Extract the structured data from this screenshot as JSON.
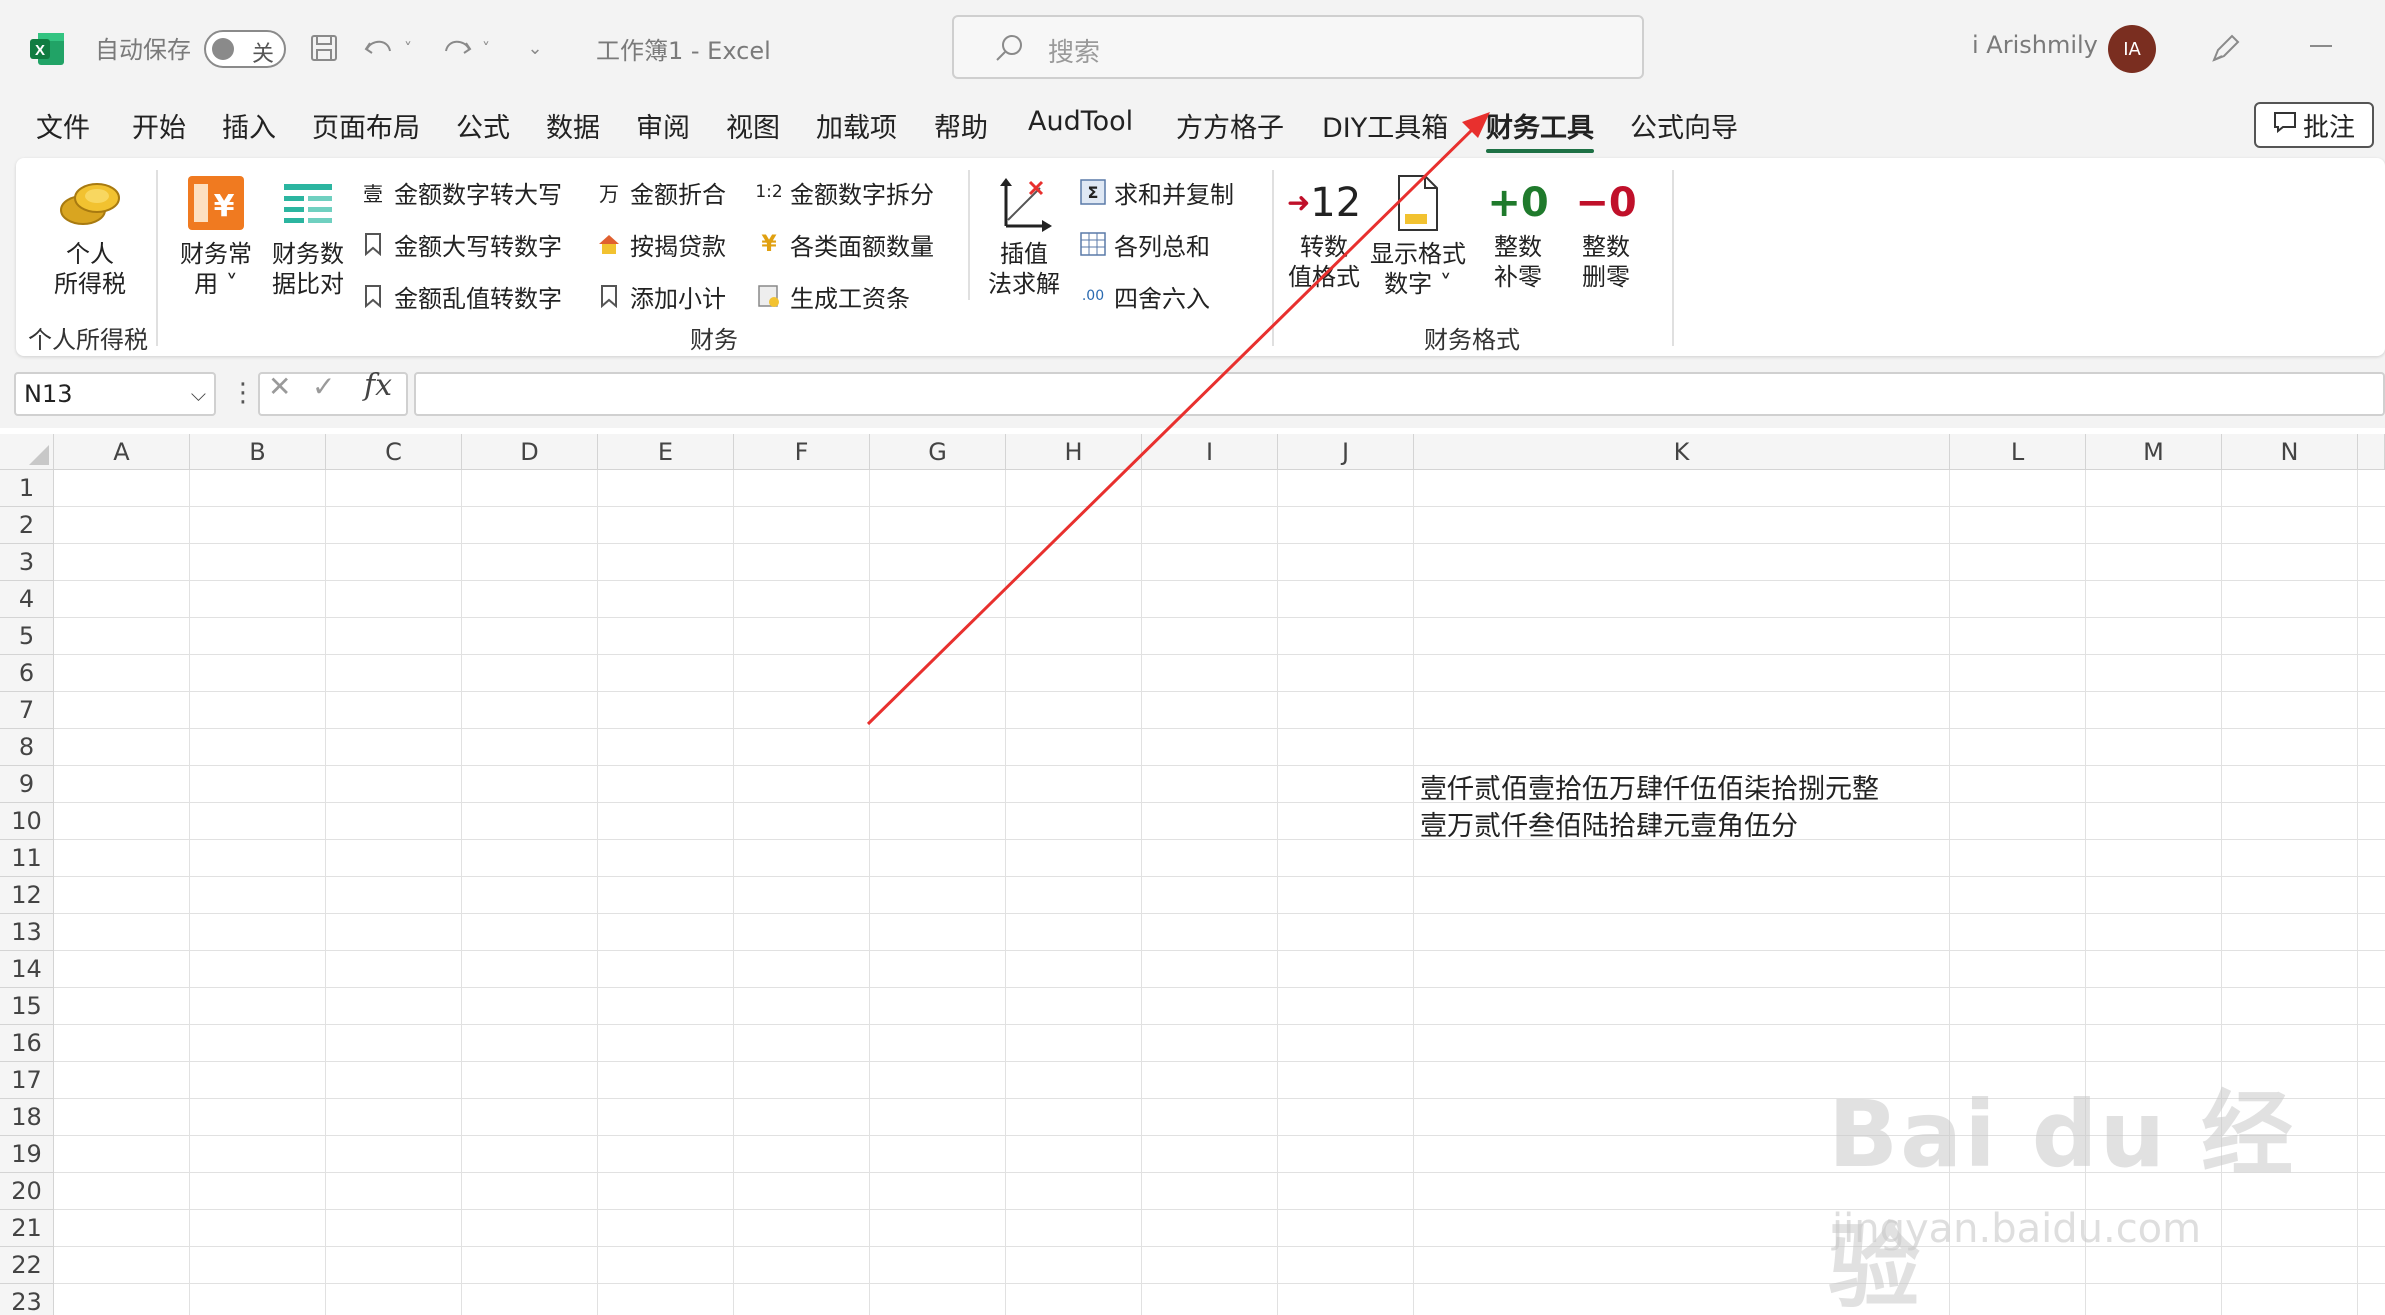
{
  "titlebar": {
    "autosave_label": "自动保存",
    "autosave_state": "关",
    "doc_title": "工作簿1  -  Excel",
    "search_placeholder": "搜索",
    "user_name": "i Arishmily",
    "avatar_initials": "IA"
  },
  "menu": {
    "tabs": [
      "文件",
      "开始",
      "插入",
      "页面布局",
      "公式",
      "数据",
      "审阅",
      "视图",
      "加载项",
      "帮助",
      "AudTool",
      "方方格子",
      "DIY工具箱",
      "财务工具",
      "公式向导"
    ],
    "active_tab": "财务工具",
    "comment_button": "批注"
  },
  "ribbon": {
    "group1": {
      "label": "个人所得税",
      "btn_income_tax": "个人\n所得税"
    },
    "group2": {
      "label": "财务",
      "btn_common": "财务常\n用 ˅",
      "btn_compare": "财务数\n据比对",
      "col1": [
        "金额数字转大写",
        "金额大写转数字",
        "金额乱值转数字"
      ],
      "col2": [
        "金额折合",
        "按揭贷款",
        "添加小计"
      ],
      "col3": [
        "金额数字拆分",
        "各类面额数量",
        "生成工资条"
      ],
      "btn_interp": "插值\n法求解",
      "col4": [
        "求和并复制",
        "各列总和",
        "四舍六入"
      ]
    },
    "group3": {
      "label": "财务格式",
      "btn_convert": "转数\n值格式",
      "btn_display": "显示格式\n数字 ˅",
      "btn_pad": "整数\n补零",
      "btn_delete": "整数\n删零",
      "icon_convert": "12",
      "icon_pad": "+0",
      "icon_delete": "−0"
    }
  },
  "formula_bar": {
    "name_box": "N13",
    "dots": "⋮",
    "fx": "fx",
    "formula": ""
  },
  "grid": {
    "columns": [
      "A",
      "B",
      "C",
      "D",
      "E",
      "F",
      "G",
      "H",
      "I",
      "J",
      "K",
      "L",
      "M",
      "N"
    ],
    "rows": [
      "1",
      "2",
      "3",
      "4",
      "5",
      "6",
      "7",
      "8",
      "9",
      "10",
      "11",
      "12",
      "13",
      "14",
      "15",
      "16",
      "17",
      "18",
      "19",
      "20",
      "21",
      "22",
      "23"
    ],
    "cells": {
      "K9": "壹仟贰佰壹拾伍万肆仟伍佰柒拾捌元整",
      "K10": "壹万贰仟叁佰陆拾肆元壹角伍分"
    }
  },
  "watermark": {
    "brand": "Bai du 经验",
    "url": "jingyan.baidu.com"
  },
  "colors": {
    "excel_green": "#1e7145",
    "arrow_red": "#e8302e",
    "avatar_bg": "#7a2e20"
  }
}
